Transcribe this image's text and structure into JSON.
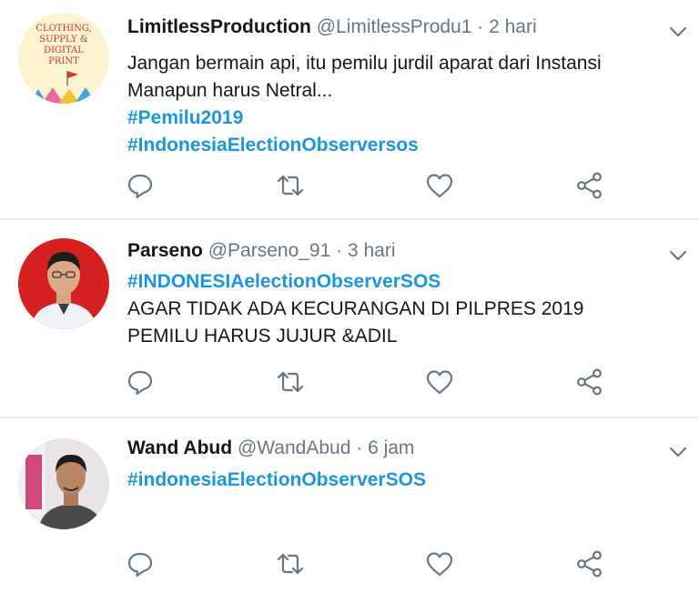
{
  "tweets": [
    {
      "display_name": "LimitlessProduction",
      "handle": "@LimitlessProdu1",
      "separator": "·",
      "time": "2 hari",
      "lines": [
        {
          "text": "Jangan bermain api, itu pemilu jurdil aparat dari Instansi",
          "hashtag": false
        },
        {
          "text": "Manapun harus Netral...",
          "hashtag": false
        },
        {
          "text": "#Pemilu2019",
          "hashtag": true
        },
        {
          "text": "#IndonesiaElectionObserversos",
          "hashtag": true
        }
      ],
      "avatar": {
        "line1": "CLOTHING,",
        "line2": "SUPPLY &",
        "line3": "DIGITAL",
        "line4": "PRINT"
      }
    },
    {
      "display_name": "Parseno",
      "handle": "@Parseno_91",
      "separator": "·",
      "time": "3 hari",
      "lines": [
        {
          "text": "#INDONESIAelectionObserverSOS",
          "hashtag": true
        },
        {
          "text": "AGAR TIDAK ADA KECURANGAN DI PILPRES 2019",
          "hashtag": false
        },
        {
          "text": "PEMILU HARUS JUJUR &ADIL",
          "hashtag": false
        }
      ]
    },
    {
      "display_name": "Wand Abud",
      "handle": "@WandAbud",
      "separator": "·",
      "time": "6 jam",
      "lines": [
        {
          "text": "#indonesiaElectionObserverSOS",
          "hashtag": true
        }
      ]
    }
  ],
  "icons": {
    "reply": "reply-icon",
    "retweet": "retweet-icon",
    "like": "heart-icon",
    "share": "share-icon",
    "menu": "chevron-down-icon"
  },
  "colors": {
    "hashtag": "#1b95e0",
    "name": "#14171a",
    "meta": "#657786",
    "icon": "#657786",
    "divider": "#e6ecf0"
  }
}
